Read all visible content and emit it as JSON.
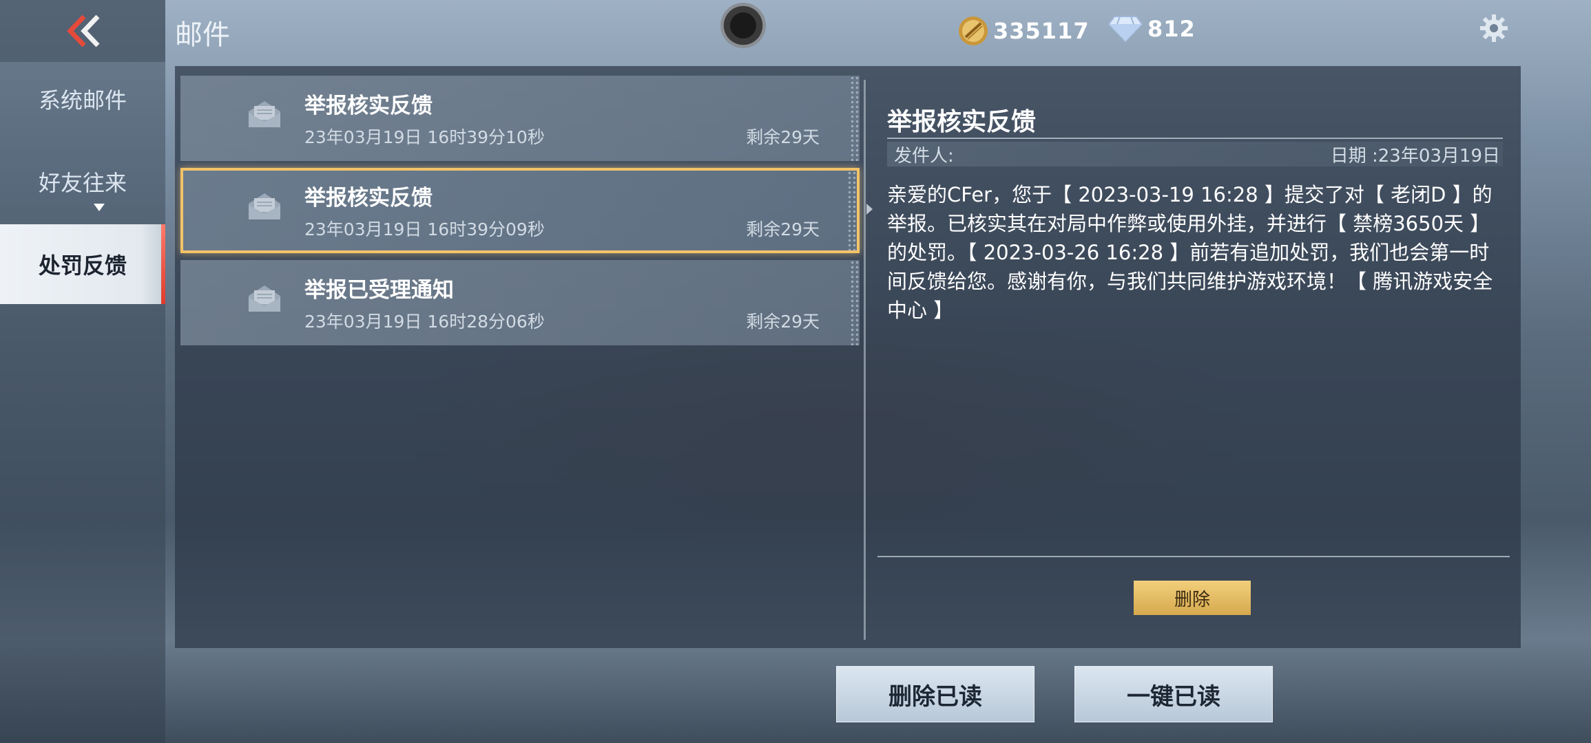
{
  "header": {
    "title": "邮件",
    "gold": "335117",
    "diamonds": "812"
  },
  "sidebar": {
    "back_icon": "double-chevron-left-icon",
    "items": [
      {
        "label": "系统邮件",
        "active": false
      },
      {
        "label": "好友往来",
        "active": false
      },
      {
        "label": "处罚反馈",
        "active": true
      }
    ]
  },
  "mail_list": [
    {
      "subject": "举报核实反馈",
      "date": "23年03月19日 16时39分10秒",
      "remaining": "剩余29天",
      "selected": false
    },
    {
      "subject": "举报核实反馈",
      "date": "23年03月19日 16时39分09秒",
      "remaining": "剩余29天",
      "selected": true
    },
    {
      "subject": "举报已受理通知",
      "date": "23年03月19日 16时28分06秒",
      "remaining": "剩余29天",
      "selected": false
    }
  ],
  "detail": {
    "title": "举报核实反馈",
    "sender_label": "发件人:",
    "date_label": "日期 :23年03月19日",
    "body": "亲爱的CFer，您于【 2023-03-19 16:28 】提交了对【 老闭D 】的举报。已核实其在对局中作弊或使用外挂，并进行【 禁榜3650天 】的处罚。【 2023-03-26 16:28 】前若有追加处罚，我们也会第一时间反馈给您。感谢有你，与我们共同维护游戏环境！【 腾讯游戏安全中心 】",
    "delete_label": "删除"
  },
  "footer": {
    "delete_read_label": "删除已读",
    "mark_all_read_label": "一键已读"
  },
  "colors": {
    "accent_gold": "#f3c36a",
    "active_tab_bar": "#e03a2a"
  }
}
